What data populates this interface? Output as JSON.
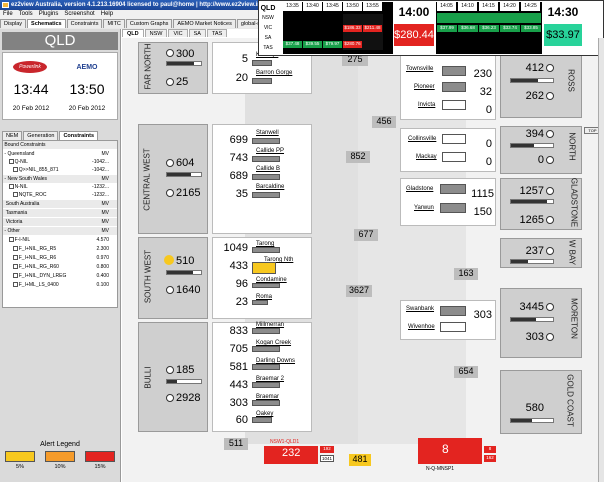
{
  "window": {
    "title": "ez2view Australia, version 4.1.213.16904 licensed to paul@home | http://www.ez2view.info",
    "min": "_",
    "max": "□",
    "close": "×"
  },
  "menu": [
    "File",
    "Tools",
    "Plugins",
    "Screenshot",
    "Help"
  ],
  "tabs": [
    "Display",
    "Schematics",
    "Constraints",
    "MITC",
    "Custom Graphs",
    "AEMO Market Notices",
    "global-roam Messages"
  ],
  "subtabs": [
    "QLD",
    "NSW",
    "VIC",
    "SA",
    "TAS"
  ],
  "left": {
    "region": "QLD",
    "logo1": "Powerlink",
    "logo2": "AEMO",
    "clock1": "13:44",
    "clock2": "13:50",
    "date1": "20 Feb 2012",
    "date2": "20 Feb 2012",
    "ctabs": [
      "NEM",
      "Generation",
      "Constraints"
    ],
    "cheader": "Bound Constraints",
    "cmv": "MV",
    "rows": [
      {
        "label": "Queensland",
        "mv": "MV"
      },
      {
        "label": "Q-NIL",
        "mv": "-1042..."
      },
      {
        "label": "Q>>NIL_855_871",
        "mv": "-1042..."
      },
      {
        "label": "New South Wales",
        "mv": "MV"
      },
      {
        "label": "N-NIL",
        "mv": "-1232..."
      },
      {
        "label": "NQTE_ROC",
        "mv": "-1232..."
      },
      {
        "label": "South Australia",
        "mv": "MV"
      },
      {
        "label": "Tasmania",
        "mv": "MV"
      },
      {
        "label": "Victoria",
        "mv": "MV"
      },
      {
        "label": "Other",
        "mv": "MV"
      },
      {
        "label": "F-I-NIL",
        "mv": "4.570"
      },
      {
        "label": "F_I+NIL_RG_R5",
        "mv": "2.300"
      },
      {
        "label": "F_I+NIL_RG_R6",
        "mv": "0.970"
      },
      {
        "label": "F_I+NIL_RG_R60",
        "mv": "0.800"
      },
      {
        "label": "F_I+NIL_DYN_LREG",
        "mv": "0.400"
      },
      {
        "label": "F_I+ML_LS_0400",
        "mv": "0.100"
      }
    ],
    "alert": {
      "title": "Alert Legend",
      "levels": [
        {
          "label": "5%",
          "color": "#f7c81f"
        },
        {
          "label": "10%",
          "color": "#f59b2a"
        },
        {
          "label": "15%",
          "color": "#e32420"
        }
      ]
    }
  },
  "prices": {
    "times": [
      "13:35",
      "13:40",
      "13:45",
      "13:50",
      "13:55",
      "14:00"
    ],
    "states": [
      "QLD",
      "NSW",
      "VIC",
      "SA",
      "TAS"
    ],
    "row1": [
      "$37.48",
      "$39.55",
      "$79.97",
      "$280.76"
    ],
    "row1b": [
      "$186.33",
      "$211.48"
    ],
    "t1": "14:00",
    "p1": "$280.44",
    "times2": [
      "14:05",
      "14:10",
      "14:15",
      "14:20",
      "14:25"
    ],
    "row2": [
      "$37.99",
      "$36.68",
      "$36.23",
      "$33.74",
      "$33.85"
    ],
    "t2": "14:30",
    "p2": "$33.97"
  },
  "regions": {
    "far_north": {
      "name": "FAR NORTH",
      "v1": "300",
      "v2": "25"
    },
    "central_west": {
      "name": "CENTRAL WEST",
      "v1": "604",
      "v2": "2165"
    },
    "south_west": {
      "name": "SOUTH WEST",
      "v1": "510",
      "v2": "1640"
    },
    "bulli": {
      "name": "BULLI",
      "v1": "185",
      "v2": "2928"
    },
    "ross": {
      "name": "ROSS",
      "v1": "412",
      "v2": "262"
    },
    "north": {
      "name": "NORTH",
      "v1": "394",
      "v2": "0"
    },
    "gladstone": {
      "name": "GLADSTONE",
      "v1": "1257",
      "v2": "1265"
    },
    "wide_bay": {
      "name": "W BAY",
      "v1": "237",
      "v2": ""
    },
    "moreton": {
      "name": "MORETON",
      "v1": "3445",
      "v2": "303"
    },
    "gold_coast": {
      "name": "GOLD COAST",
      "v1": "580",
      "v2": ""
    }
  },
  "gens_left": [
    {
      "name": "Kareeya",
      "v": "5"
    },
    {
      "name": "Barron Gorge",
      "v": "20"
    },
    {
      "name": "Stanwell",
      "v": "699"
    },
    {
      "name": "Callide PP",
      "v": "743"
    },
    {
      "name": "Callide B",
      "v": "689"
    },
    {
      "name": "Barcaldine",
      "v": "35"
    },
    {
      "name": "Tarong",
      "v": "1049"
    },
    {
      "name": "Tarong Nth",
      "v": "433"
    },
    {
      "name": "Condamine",
      "v": "96"
    },
    {
      "name": "Roma",
      "v": "23"
    },
    {
      "name": "Millmerran",
      "v": "833"
    },
    {
      "name": "Kogan Creek",
      "v": "705"
    },
    {
      "name": "Darling Downs",
      "v": "581"
    },
    {
      "name": "Braemar 2",
      "v": "443"
    },
    {
      "name": "Braemar",
      "v": "303"
    },
    {
      "name": "Oakey",
      "v": "60"
    }
  ],
  "gens_right": [
    {
      "name": "Townsville",
      "v": "230"
    },
    {
      "name": "Pioneer",
      "v": "32"
    },
    {
      "name": "Invicta",
      "v": "0"
    },
    {
      "name": "Collinsville",
      "v": "0"
    },
    {
      "name": "Mackay",
      "v": "0"
    },
    {
      "name": "Gladstone",
      "v": "1115"
    },
    {
      "name": "Yarwun",
      "v": "150"
    },
    {
      "name": "Swanbank",
      "v": "303"
    },
    {
      "name": "Wivenhoe",
      "v": "0"
    }
  ],
  "flows": {
    "f275": "275",
    "f456": "456",
    "f852": "852",
    "f677": "677",
    "f3627": "3627",
    "f163": "163",
    "f654": "654",
    "f511": "511",
    "f481": "481"
  },
  "interconnectors": {
    "nsw1": {
      "label": "NSW1-QLD1",
      "v": "232",
      "lim1": "192",
      "lim2": "1041"
    },
    "nq": {
      "label": "N-Q-MNSP1",
      "v": "8",
      "lim1": "8",
      "lim2": "162"
    }
  },
  "top_button": "TOP"
}
